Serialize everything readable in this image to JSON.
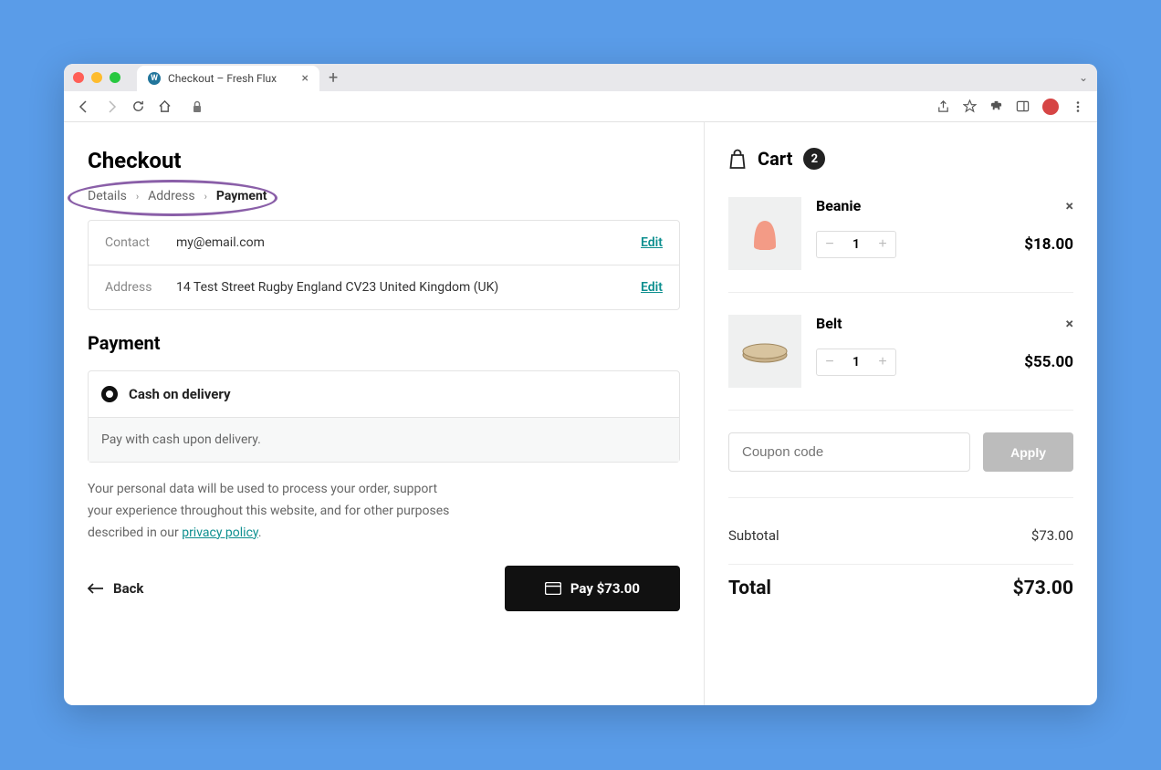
{
  "browser": {
    "tab_title": "Checkout – Fresh Flux",
    "favicon_glyph": "W"
  },
  "page": {
    "title": "Checkout",
    "breadcrumb": {
      "step1": "Details",
      "step2": "Address",
      "step3": "Payment"
    },
    "info": {
      "contact_label": "Contact",
      "contact_value": "my@email.com",
      "contact_edit": "Edit",
      "address_label": "Address",
      "address_value": "14 Test Street Rugby England CV23 United Kingdom (UK)",
      "address_edit": "Edit"
    },
    "payment": {
      "heading": "Payment",
      "option_label": "Cash on delivery",
      "option_desc": "Pay with cash upon delivery."
    },
    "privacy": {
      "text_before": "Your personal data will be used to process your order, support your experience throughout this website, and for other purposes described in our ",
      "link": "privacy policy",
      "text_after": "."
    },
    "actions": {
      "back": "Back",
      "pay": "Pay $73.00"
    }
  },
  "cart": {
    "heading": "Cart",
    "count": "2",
    "items": [
      {
        "name": "Beanie",
        "qty": "1",
        "price": "$18.00",
        "img_color": "#f39b86"
      },
      {
        "name": "Belt",
        "qty": "1",
        "price": "$55.00",
        "img_color": "#c7b089"
      }
    ],
    "coupon_placeholder": "Coupon code",
    "apply": "Apply",
    "subtotal_label": "Subtotal",
    "subtotal_value": "$73.00",
    "total_label": "Total",
    "total_value": "$73.00"
  }
}
